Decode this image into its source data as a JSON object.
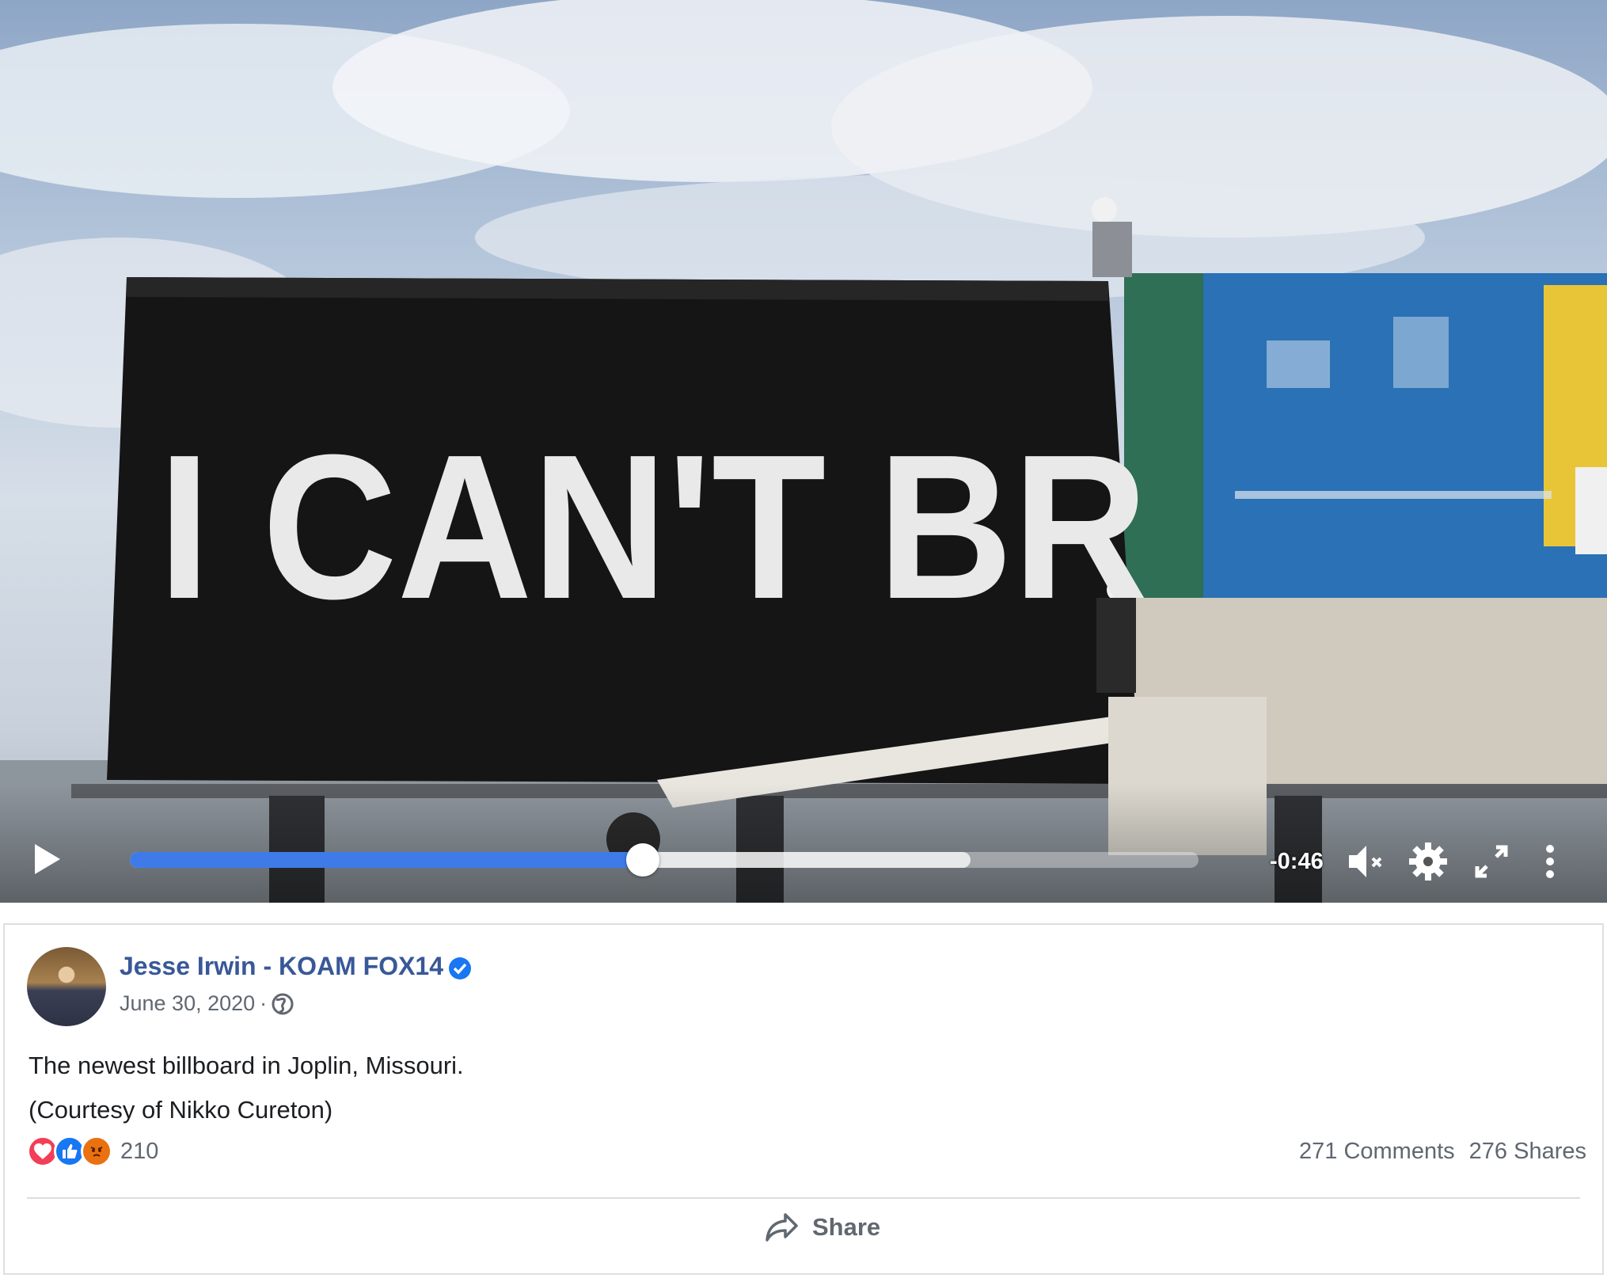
{
  "video": {
    "billboard_text": "I CAN'T BR",
    "time_remaining": "-0:46",
    "progress_played": 0.48,
    "progress_buffered": 0.787,
    "colors": {
      "progress_played": "#3f7be8"
    }
  },
  "post": {
    "author": "Jesse Irwin - KOAM FOX14",
    "date": "June 30, 2020",
    "separator": "·",
    "text_line1": "The newest billboard in Joplin, Missouri.",
    "text_line2": "(Courtesy of Nikko Cureton)",
    "reaction_count": "210",
    "comments": "271 Comments",
    "shares": "276 Shares",
    "share_label": "Share",
    "colors": {
      "author": "#385898",
      "verified": "#1877f2",
      "love": "#f33e58",
      "like": "#1877f2",
      "angry": "#e9710f"
    }
  },
  "icons": [
    "play-icon",
    "volume-muted-icon",
    "gear-icon",
    "fullscreen-icon",
    "more-icon",
    "verified-icon",
    "globe-icon",
    "love-reaction-icon",
    "like-reaction-icon",
    "angry-reaction-icon",
    "share-icon"
  ]
}
